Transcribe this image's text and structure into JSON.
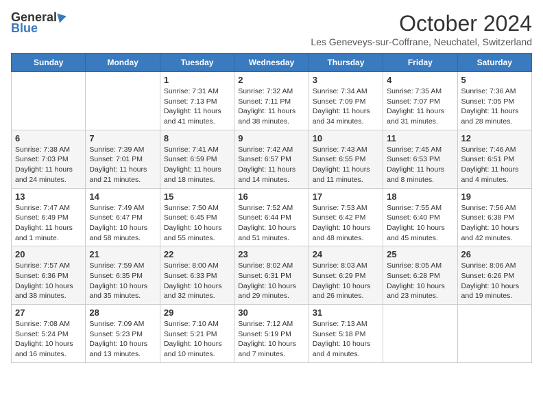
{
  "header": {
    "logo_general": "General",
    "logo_blue": "Blue",
    "month": "October 2024",
    "location": "Les Geneveys-sur-Coffrane, Neuchatel, Switzerland"
  },
  "weekdays": [
    "Sunday",
    "Monday",
    "Tuesday",
    "Wednesday",
    "Thursday",
    "Friday",
    "Saturday"
  ],
  "weeks": [
    [
      {
        "day": "",
        "sunrise": "",
        "sunset": "",
        "daylight": ""
      },
      {
        "day": "",
        "sunrise": "",
        "sunset": "",
        "daylight": ""
      },
      {
        "day": "1",
        "sunrise": "Sunrise: 7:31 AM",
        "sunset": "Sunset: 7:13 PM",
        "daylight": "Daylight: 11 hours and 41 minutes."
      },
      {
        "day": "2",
        "sunrise": "Sunrise: 7:32 AM",
        "sunset": "Sunset: 7:11 PM",
        "daylight": "Daylight: 11 hours and 38 minutes."
      },
      {
        "day": "3",
        "sunrise": "Sunrise: 7:34 AM",
        "sunset": "Sunset: 7:09 PM",
        "daylight": "Daylight: 11 hours and 34 minutes."
      },
      {
        "day": "4",
        "sunrise": "Sunrise: 7:35 AM",
        "sunset": "Sunset: 7:07 PM",
        "daylight": "Daylight: 11 hours and 31 minutes."
      },
      {
        "day": "5",
        "sunrise": "Sunrise: 7:36 AM",
        "sunset": "Sunset: 7:05 PM",
        "daylight": "Daylight: 11 hours and 28 minutes."
      }
    ],
    [
      {
        "day": "6",
        "sunrise": "Sunrise: 7:38 AM",
        "sunset": "Sunset: 7:03 PM",
        "daylight": "Daylight: 11 hours and 24 minutes."
      },
      {
        "day": "7",
        "sunrise": "Sunrise: 7:39 AM",
        "sunset": "Sunset: 7:01 PM",
        "daylight": "Daylight: 11 hours and 21 minutes."
      },
      {
        "day": "8",
        "sunrise": "Sunrise: 7:41 AM",
        "sunset": "Sunset: 6:59 PM",
        "daylight": "Daylight: 11 hours and 18 minutes."
      },
      {
        "day": "9",
        "sunrise": "Sunrise: 7:42 AM",
        "sunset": "Sunset: 6:57 PM",
        "daylight": "Daylight: 11 hours and 14 minutes."
      },
      {
        "day": "10",
        "sunrise": "Sunrise: 7:43 AM",
        "sunset": "Sunset: 6:55 PM",
        "daylight": "Daylight: 11 hours and 11 minutes."
      },
      {
        "day": "11",
        "sunrise": "Sunrise: 7:45 AM",
        "sunset": "Sunset: 6:53 PM",
        "daylight": "Daylight: 11 hours and 8 minutes."
      },
      {
        "day": "12",
        "sunrise": "Sunrise: 7:46 AM",
        "sunset": "Sunset: 6:51 PM",
        "daylight": "Daylight: 11 hours and 4 minutes."
      }
    ],
    [
      {
        "day": "13",
        "sunrise": "Sunrise: 7:47 AM",
        "sunset": "Sunset: 6:49 PM",
        "daylight": "Daylight: 11 hours and 1 minute."
      },
      {
        "day": "14",
        "sunrise": "Sunrise: 7:49 AM",
        "sunset": "Sunset: 6:47 PM",
        "daylight": "Daylight: 10 hours and 58 minutes."
      },
      {
        "day": "15",
        "sunrise": "Sunrise: 7:50 AM",
        "sunset": "Sunset: 6:45 PM",
        "daylight": "Daylight: 10 hours and 55 minutes."
      },
      {
        "day": "16",
        "sunrise": "Sunrise: 7:52 AM",
        "sunset": "Sunset: 6:44 PM",
        "daylight": "Daylight: 10 hours and 51 minutes."
      },
      {
        "day": "17",
        "sunrise": "Sunrise: 7:53 AM",
        "sunset": "Sunset: 6:42 PM",
        "daylight": "Daylight: 10 hours and 48 minutes."
      },
      {
        "day": "18",
        "sunrise": "Sunrise: 7:55 AM",
        "sunset": "Sunset: 6:40 PM",
        "daylight": "Daylight: 10 hours and 45 minutes."
      },
      {
        "day": "19",
        "sunrise": "Sunrise: 7:56 AM",
        "sunset": "Sunset: 6:38 PM",
        "daylight": "Daylight: 10 hours and 42 minutes."
      }
    ],
    [
      {
        "day": "20",
        "sunrise": "Sunrise: 7:57 AM",
        "sunset": "Sunset: 6:36 PM",
        "daylight": "Daylight: 10 hours and 38 minutes."
      },
      {
        "day": "21",
        "sunrise": "Sunrise: 7:59 AM",
        "sunset": "Sunset: 6:35 PM",
        "daylight": "Daylight: 10 hours and 35 minutes."
      },
      {
        "day": "22",
        "sunrise": "Sunrise: 8:00 AM",
        "sunset": "Sunset: 6:33 PM",
        "daylight": "Daylight: 10 hours and 32 minutes."
      },
      {
        "day": "23",
        "sunrise": "Sunrise: 8:02 AM",
        "sunset": "Sunset: 6:31 PM",
        "daylight": "Daylight: 10 hours and 29 minutes."
      },
      {
        "day": "24",
        "sunrise": "Sunrise: 8:03 AM",
        "sunset": "Sunset: 6:29 PM",
        "daylight": "Daylight: 10 hours and 26 minutes."
      },
      {
        "day": "25",
        "sunrise": "Sunrise: 8:05 AM",
        "sunset": "Sunset: 6:28 PM",
        "daylight": "Daylight: 10 hours and 23 minutes."
      },
      {
        "day": "26",
        "sunrise": "Sunrise: 8:06 AM",
        "sunset": "Sunset: 6:26 PM",
        "daylight": "Daylight: 10 hours and 19 minutes."
      }
    ],
    [
      {
        "day": "27",
        "sunrise": "Sunrise: 7:08 AM",
        "sunset": "Sunset: 5:24 PM",
        "daylight": "Daylight: 10 hours and 16 minutes."
      },
      {
        "day": "28",
        "sunrise": "Sunrise: 7:09 AM",
        "sunset": "Sunset: 5:23 PM",
        "daylight": "Daylight: 10 hours and 13 minutes."
      },
      {
        "day": "29",
        "sunrise": "Sunrise: 7:10 AM",
        "sunset": "Sunset: 5:21 PM",
        "daylight": "Daylight: 10 hours and 10 minutes."
      },
      {
        "day": "30",
        "sunrise": "Sunrise: 7:12 AM",
        "sunset": "Sunset: 5:19 PM",
        "daylight": "Daylight: 10 hours and 7 minutes."
      },
      {
        "day": "31",
        "sunrise": "Sunrise: 7:13 AM",
        "sunset": "Sunset: 5:18 PM",
        "daylight": "Daylight: 10 hours and 4 minutes."
      },
      {
        "day": "",
        "sunrise": "",
        "sunset": "",
        "daylight": ""
      },
      {
        "day": "",
        "sunrise": "",
        "sunset": "",
        "daylight": ""
      }
    ]
  ]
}
